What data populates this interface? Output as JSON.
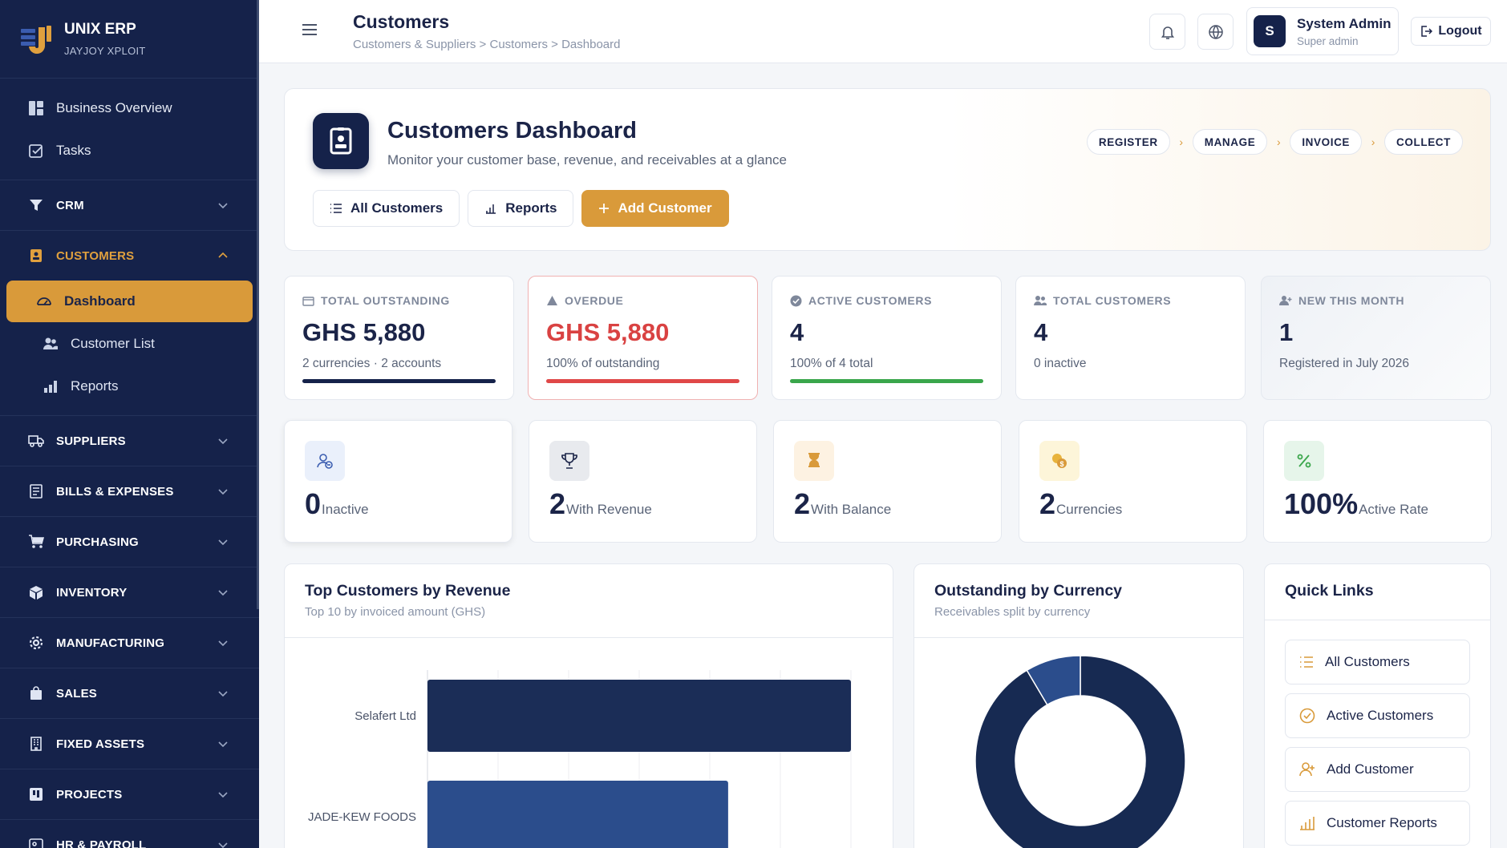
{
  "brand": {
    "name": "UNIX ERP",
    "subtitle": "JAYJOY XPLOIT"
  },
  "sidebar": {
    "top_items": [
      {
        "label": "Business Overview",
        "icon": "dashboard-grid-icon"
      },
      {
        "label": "Tasks",
        "icon": "task-checkbox-icon"
      }
    ],
    "sections": [
      {
        "label": "CRM",
        "icon": "funnel-icon"
      },
      {
        "label": "CUSTOMERS",
        "icon": "contact-card-icon"
      },
      {
        "label": "SUPPLIERS",
        "icon": "truck-icon"
      },
      {
        "label": "BILLS & EXPENSES",
        "icon": "receipt-icon"
      },
      {
        "label": "PURCHASING",
        "icon": "cart-icon"
      },
      {
        "label": "INVENTORY",
        "icon": "box-icon"
      },
      {
        "label": "MANUFACTURING",
        "icon": "gear-icon"
      },
      {
        "label": "SALES",
        "icon": "shopping-bag-icon"
      },
      {
        "label": "FIXED ASSETS",
        "icon": "building-icon"
      },
      {
        "label": "PROJECTS",
        "icon": "project-icon"
      },
      {
        "label": "HR & PAYROLL",
        "icon": "id-badge-icon"
      }
    ],
    "customer_items": [
      {
        "label": "Dashboard",
        "icon": "speedometer-icon"
      },
      {
        "label": "Customer List",
        "icon": "users-icon"
      },
      {
        "label": "Reports",
        "icon": "bar-chart-icon"
      }
    ]
  },
  "header": {
    "title": "Customers",
    "breadcrumb": "Customers & Suppliers > Customers > Dashboard",
    "user": {
      "initial": "S",
      "name": "System Admin",
      "role": "Super admin"
    },
    "logout_label": "Logout"
  },
  "hero": {
    "title": "Customers Dashboard",
    "subtitle": "Monitor your customer base, revenue, and receivables at a glance",
    "flow": [
      "REGISTER",
      "MANAGE",
      "INVOICE",
      "COLLECT"
    ],
    "actions": {
      "all_customers": "All Customers",
      "reports": "Reports",
      "add_customer": "Add Customer"
    }
  },
  "stats": [
    {
      "label": "TOTAL OUTSTANDING",
      "value": "GHS 5,880",
      "desc": "2 currencies · 2 accounts",
      "progress": 100,
      "bar_color": "#15224a"
    },
    {
      "label": "OVERDUE",
      "value": "GHS 5,880",
      "desc": "100% of outstanding",
      "progress": 100,
      "bar_color": "#e04848",
      "value_color": "#d94242"
    },
    {
      "label": "ACTIVE CUSTOMERS",
      "value": "4",
      "desc": "100% of 4 total",
      "progress": 100,
      "bar_color": "#3aa64b"
    },
    {
      "label": "TOTAL CUSTOMERS",
      "value": "4",
      "desc": "0 inactive"
    },
    {
      "label": "NEW THIS MONTH",
      "value": "1",
      "desc": "Registered in July 2026"
    }
  ],
  "minis": [
    {
      "value": "0",
      "label": "Inactive",
      "icon": "user-minus-icon"
    },
    {
      "value": "2",
      "label": "With Revenue",
      "icon": "trophy-icon"
    },
    {
      "value": "2",
      "label": "With Balance",
      "icon": "hourglass-icon"
    },
    {
      "value": "2",
      "label": "Currencies",
      "icon": "coins-icon"
    },
    {
      "value": "100%",
      "label": "Active Rate",
      "icon": "percent-icon"
    }
  ],
  "panels": {
    "top_customers": {
      "title": "Top Customers by Revenue",
      "subtitle": "Top 10 by invoiced amount (GHS)"
    },
    "by_currency": {
      "title": "Outstanding by Currency",
      "subtitle": "Receivables split by currency"
    },
    "quick_links": {
      "title": "Quick Links",
      "items": [
        "All Customers",
        "Active Customers",
        "Add Customer",
        "Customer Reports"
      ]
    }
  },
  "colors": {
    "navy": "#15224a",
    "accent": "#d99a3a",
    "danger": "#d94242",
    "success": "#3aa64b",
    "bar2": "#2b4d8c"
  },
  "chart_data": [
    {
      "type": "bar",
      "orientation": "horizontal",
      "categories": [
        "Selafert Ltd",
        "JADE-KEW FOODS"
      ],
      "values": [
        100,
        71
      ],
      "colors": [
        "#1b2d57",
        "#2b4d8c"
      ],
      "grid": true
    },
    {
      "type": "pie",
      "donut": true,
      "values": [
        91.5,
        8.5
      ],
      "colors": [
        "#172a52",
        "#2b4d8c"
      ]
    }
  ]
}
